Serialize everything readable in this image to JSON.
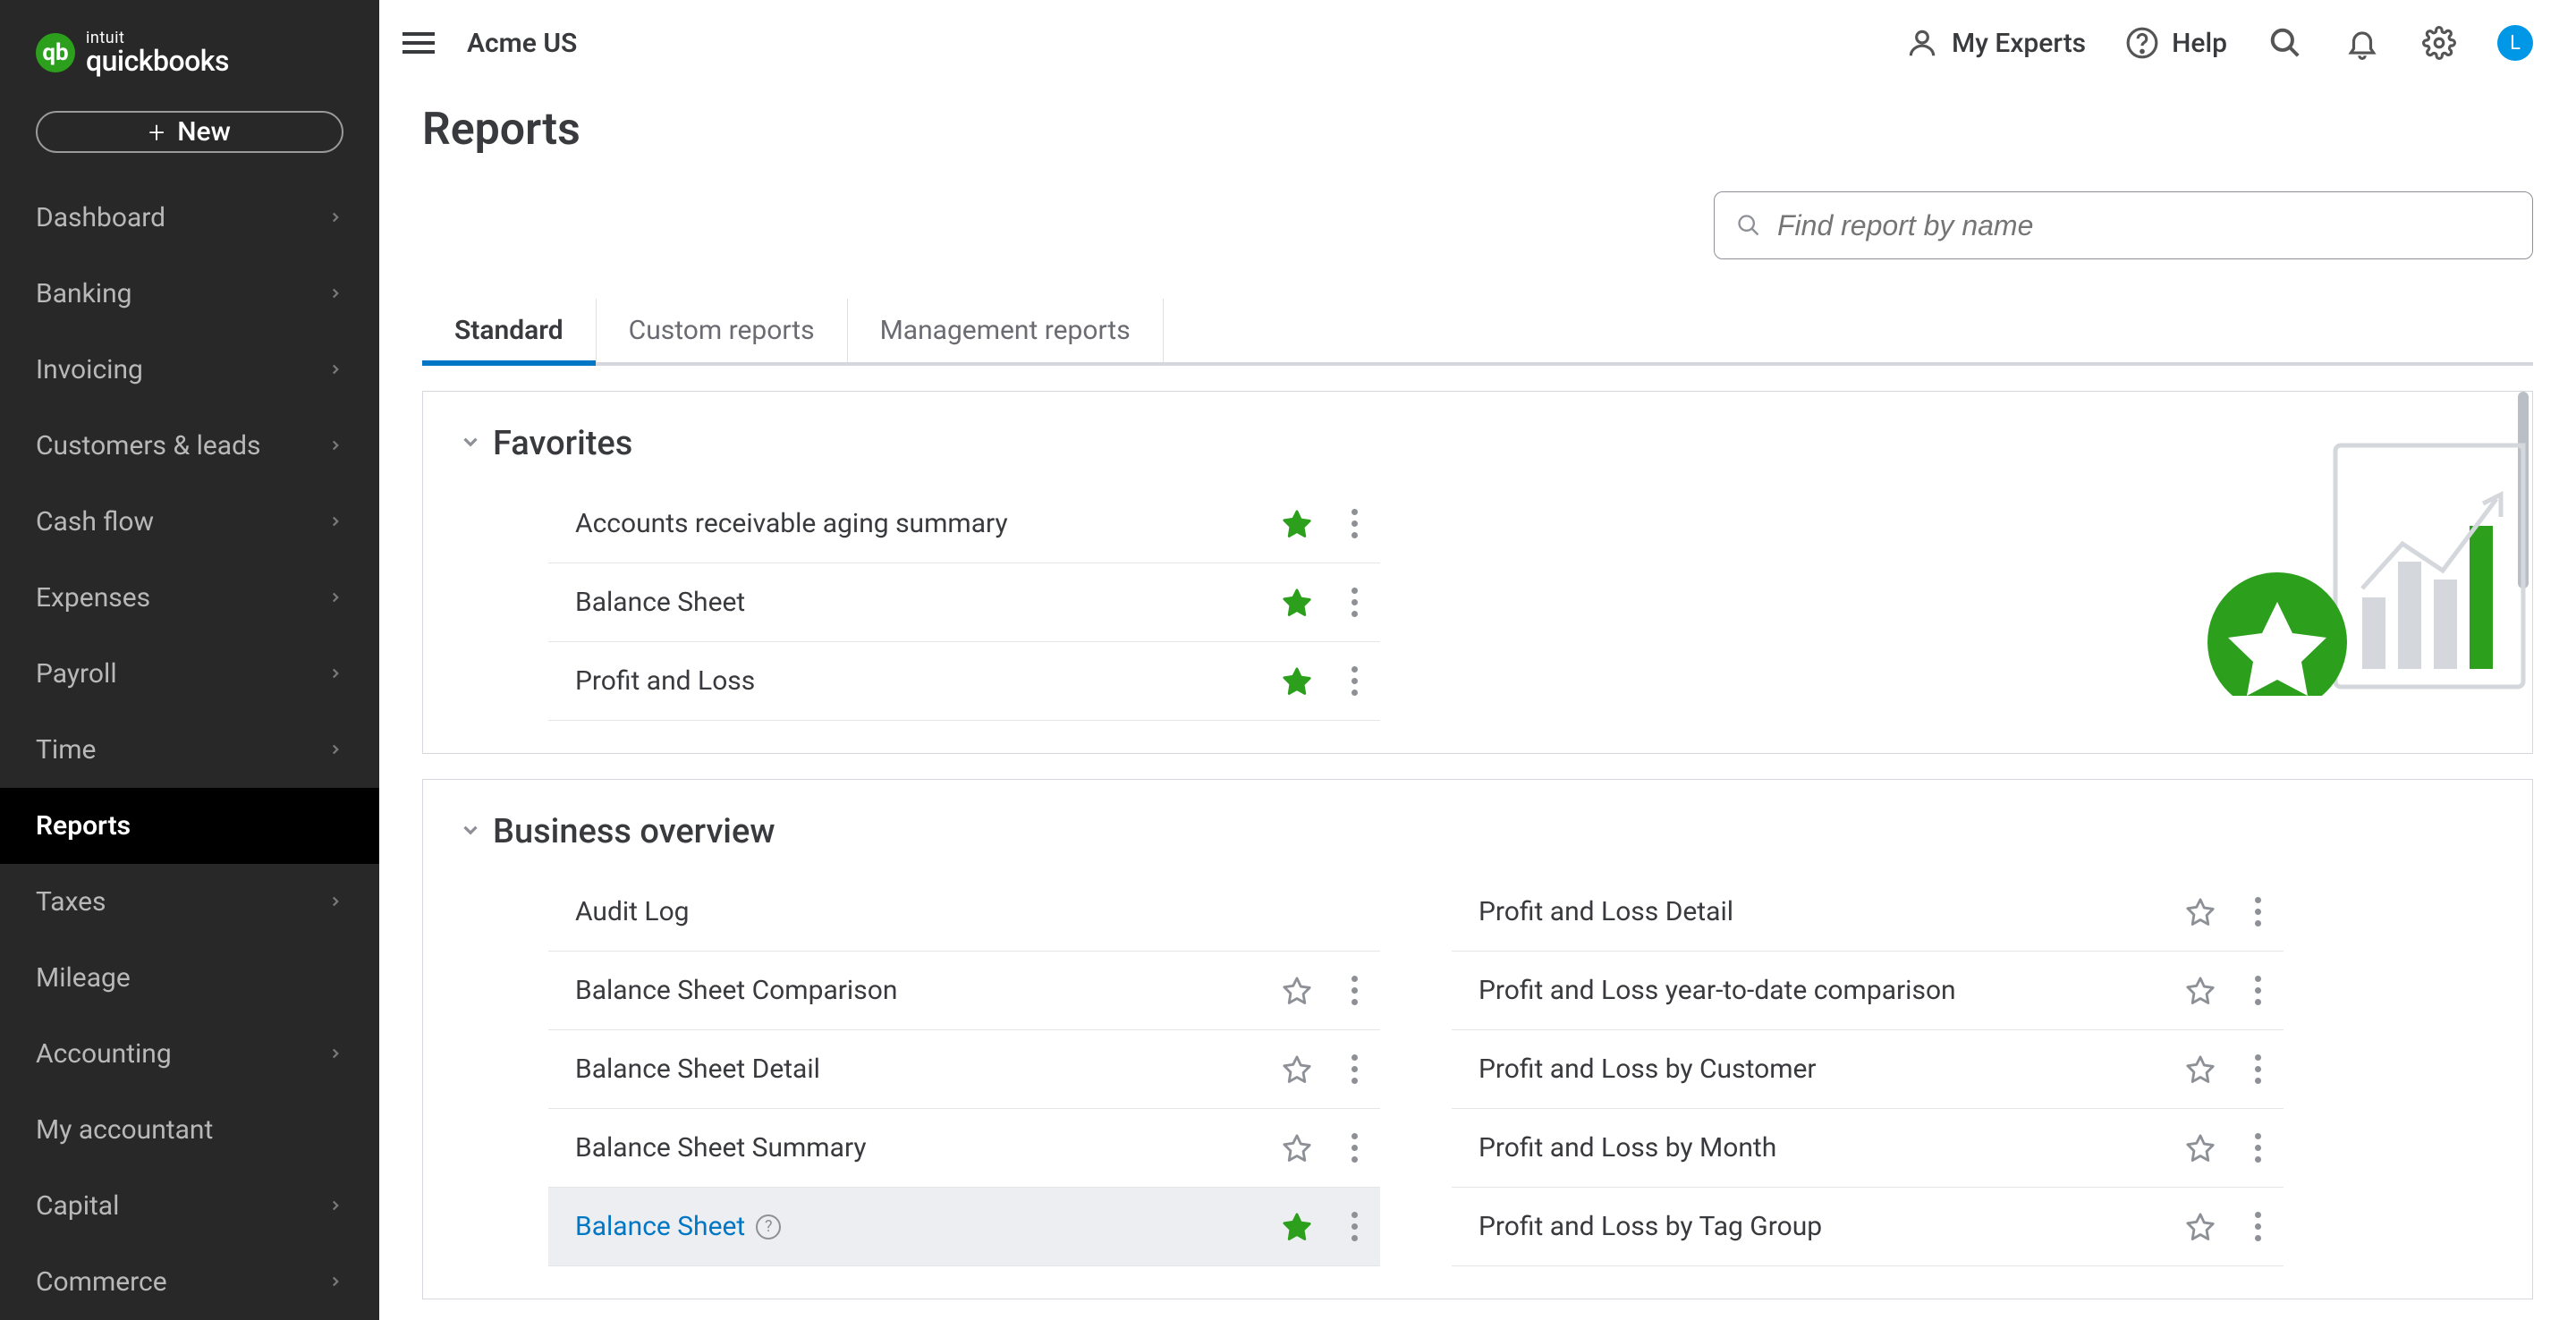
{
  "brand": {
    "small": "intuit",
    "big": "quickbooks"
  },
  "new_button": "New",
  "sidebar_items": [
    {
      "label": "Dashboard",
      "chev": true
    },
    {
      "label": "Banking",
      "chev": true
    },
    {
      "label": "Invoicing",
      "chev": true
    },
    {
      "label": "Customers & leads",
      "chev": true
    },
    {
      "label": "Cash flow",
      "chev": true
    },
    {
      "label": "Expenses",
      "chev": true
    },
    {
      "label": "Payroll",
      "chev": true
    },
    {
      "label": "Time",
      "chev": true
    },
    {
      "label": "Reports",
      "chev": false,
      "active": true
    },
    {
      "label": "Taxes",
      "chev": true
    },
    {
      "label": "Mileage",
      "chev": false
    },
    {
      "label": "Accounting",
      "chev": true
    },
    {
      "label": "My accountant",
      "chev": false
    },
    {
      "label": "Capital",
      "chev": true
    },
    {
      "label": "Commerce",
      "chev": true
    }
  ],
  "company_name": "Acme US",
  "topbar": {
    "my_experts": "My Experts",
    "help": "Help",
    "avatar_initial": "L"
  },
  "page_title": "Reports",
  "search_placeholder": "Find report by name",
  "tabs": [
    {
      "label": "Standard",
      "active": true
    },
    {
      "label": "Custom reports"
    },
    {
      "label": "Management reports"
    }
  ],
  "sections": {
    "favorites": {
      "title": "Favorites",
      "reports": [
        {
          "name": "Accounts receivable aging summary",
          "starred": true
        },
        {
          "name": "Balance Sheet",
          "starred": true
        },
        {
          "name": "Profit and Loss",
          "starred": true
        }
      ]
    },
    "business_overview": {
      "title": "Business overview",
      "left": [
        {
          "name": "Audit Log",
          "starred": false,
          "no_icons": true
        },
        {
          "name": "Balance Sheet Comparison",
          "starred": false
        },
        {
          "name": "Balance Sheet Detail",
          "starred": false
        },
        {
          "name": "Balance Sheet Summary",
          "starred": false
        },
        {
          "name": "Balance Sheet",
          "starred": true,
          "hover": true,
          "info": true
        }
      ],
      "right": [
        {
          "name": "Profit and Loss Detail",
          "starred": false
        },
        {
          "name": "Profit and Loss year-to-date comparison",
          "starred": false
        },
        {
          "name": "Profit and Loss by Customer",
          "starred": false
        },
        {
          "name": "Profit and Loss by Month",
          "starred": false
        },
        {
          "name": "Profit and Loss by Tag Group",
          "starred": false
        }
      ]
    }
  }
}
